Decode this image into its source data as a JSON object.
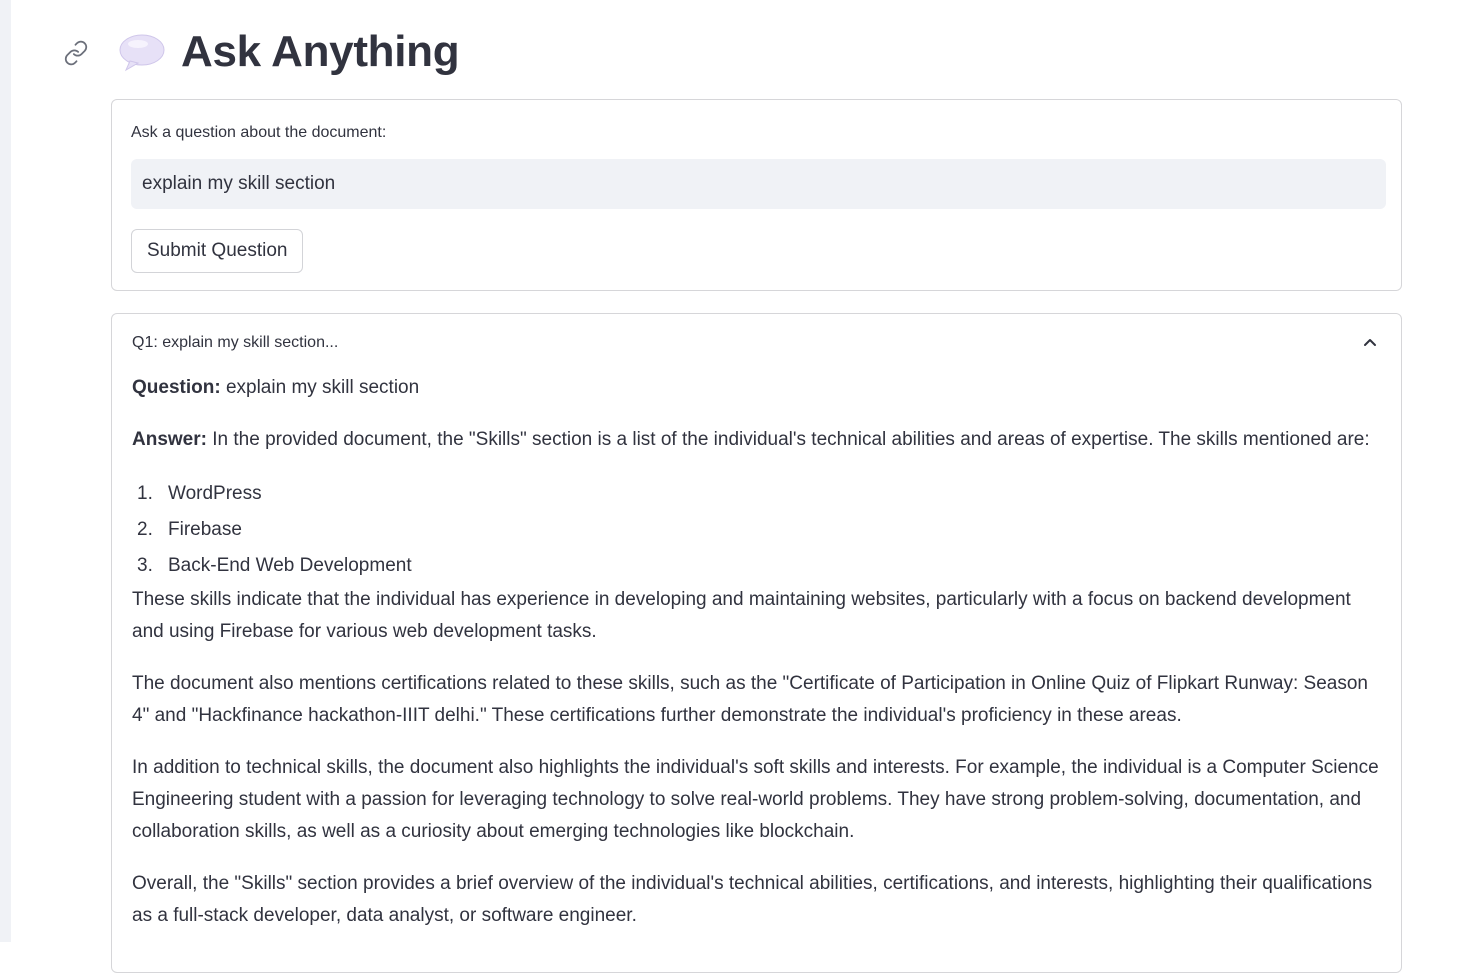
{
  "header": {
    "title": "Ask Anything",
    "link_icon": "link-icon",
    "title_icon": "speech-bubble-icon"
  },
  "form": {
    "label": "Ask a question about the document:",
    "input_value": "explain my skill section",
    "submit_label": "Submit Question"
  },
  "qa": {
    "expander_title": "Q1: explain my skill section...",
    "question_label": "Question:",
    "question_text": " explain my skill section",
    "answer_label": "Answer:",
    "answer_intro": " In the provided document, the \"Skills\" section is a list of the individual's technical abilities and areas of expertise. The skills mentioned are:",
    "skills": [
      {
        "num": "1.",
        "text": "WordPress"
      },
      {
        "num": "2.",
        "text": "Firebase"
      },
      {
        "num": "3.",
        "text": "Back-End Web Development"
      }
    ],
    "paragraphs": [
      "These skills indicate that the individual has experience in developing and maintaining websites, particularly with a focus on backend development and using Firebase for various web development tasks.",
      "The document also mentions certifications related to these skills, such as the \"Certificate of Participation in Online Quiz of Flipkart Runway: Season 4\" and \"Hackfinance hackathon-IIIT delhi.\" These certifications further demonstrate the individual's proficiency in these areas.",
      "In addition to technical skills, the document also highlights the individual's soft skills and interests. For example, the individual is a Computer Science Engineering student with a passion for leveraging technology to solve real-world problems. They have strong problem-solving, documentation, and collaboration skills, as well as a curiosity about emerging technologies like blockchain.",
      "Overall, the \"Skills\" section provides a brief overview of the individual's technical abilities, certifications, and interests, highlighting their qualifications as a full-stack developer, data analyst, or software engineer."
    ]
  },
  "colors": {
    "text": "#31333f",
    "input_bg": "#f0f2f6",
    "border": "#d6d6d9",
    "bubble": "#e3dcf5"
  }
}
